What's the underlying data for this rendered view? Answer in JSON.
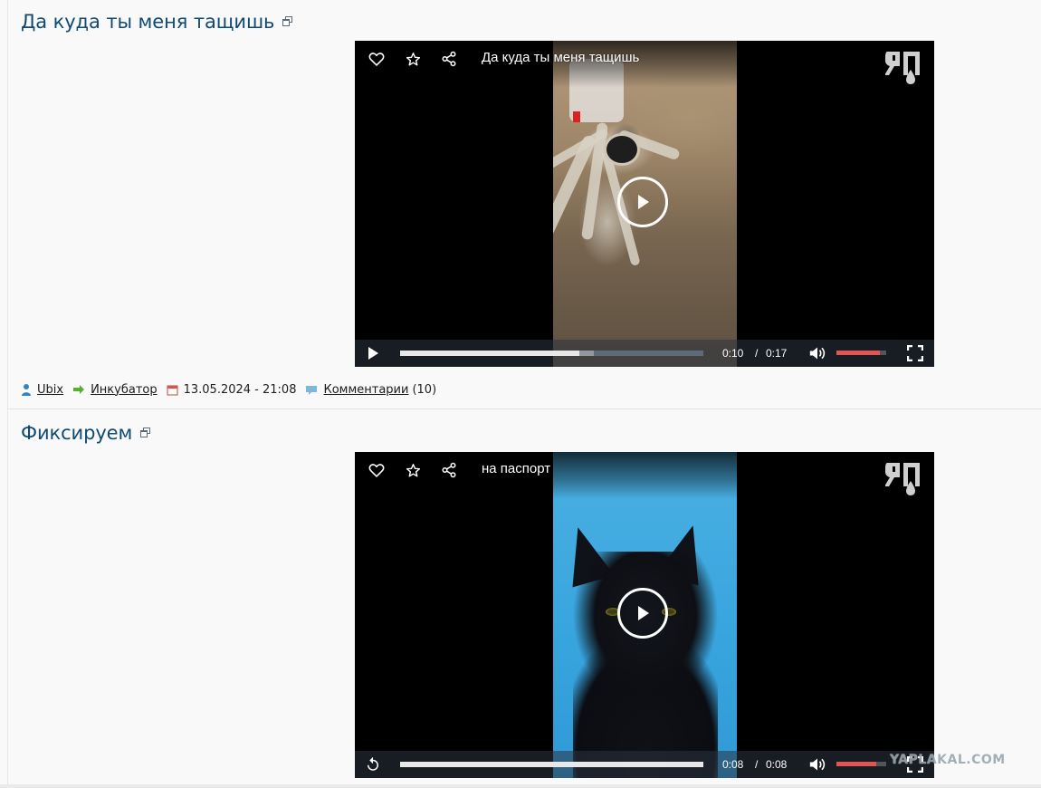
{
  "posts": [
    {
      "title": "Да куда ты меня тащишь",
      "video": {
        "title": "Да куда ты меня тащишь",
        "time_current": "0:10",
        "time_separator": "/",
        "time_total": "0:17",
        "played_fraction": 0.59,
        "buffered_fraction": 0.64,
        "volume_fraction": 0.88,
        "play_state_icon": "play-icon"
      },
      "meta": {
        "author": "Ubix",
        "section": "Инкубатор",
        "datetime": "13.05.2024 - 21:08",
        "comments_label": "Комментарии",
        "comments_count": "(10)"
      }
    },
    {
      "title": "Фиксируем",
      "video": {
        "title": "на паспорт",
        "time_current": "0:08",
        "time_separator": "/",
        "time_total": "0:08",
        "played_fraction": 1.0,
        "buffered_fraction": 1.0,
        "volume_fraction": 0.8,
        "play_state_icon": "replay-icon"
      }
    }
  ],
  "site_watermark": "YAPLAKAL.COM",
  "colors": {
    "title": "#0f4a73",
    "volume": "#e35454",
    "background": "#f9f9f9"
  }
}
